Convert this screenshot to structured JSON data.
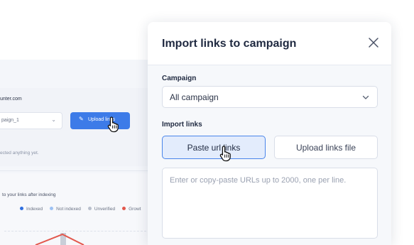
{
  "background": {
    "domain_text": "unter.com",
    "campaign_select_value": "paign_1",
    "upload_button_label": "Upload links",
    "empty_text": "ected anything yet.",
    "chart_title": "to your links after indexing",
    "legend": [
      {
        "label": "Indexed",
        "color": "#2f6fe0"
      },
      {
        "label": "Not indexed",
        "color": "#9cc1f3"
      },
      {
        "label": "Unverified",
        "color": "#b9bfcc"
      },
      {
        "label": "Growt",
        "color": "#e2574c"
      }
    ]
  },
  "modal": {
    "title": "Import links to campaign",
    "campaign_label": "Campaign",
    "campaign_value": "All campaign",
    "import_label": "Import links",
    "tab_paste_label": "Paste url links",
    "tab_upload_label": "Upload links file",
    "urls_placeholder": "Enter or copy-paste URLs up to 2000, one per line."
  },
  "colors": {
    "accent": "#3d7be8",
    "tab_active_bg": "#e3ecfc",
    "tab_active_border": "#4a85ea",
    "text_dark": "#1f2940"
  },
  "icons": {
    "close": "close-icon",
    "chevron": "chevron-down-icon",
    "cursor": "hand-pointer-icon",
    "edit": "pencil-icon"
  }
}
